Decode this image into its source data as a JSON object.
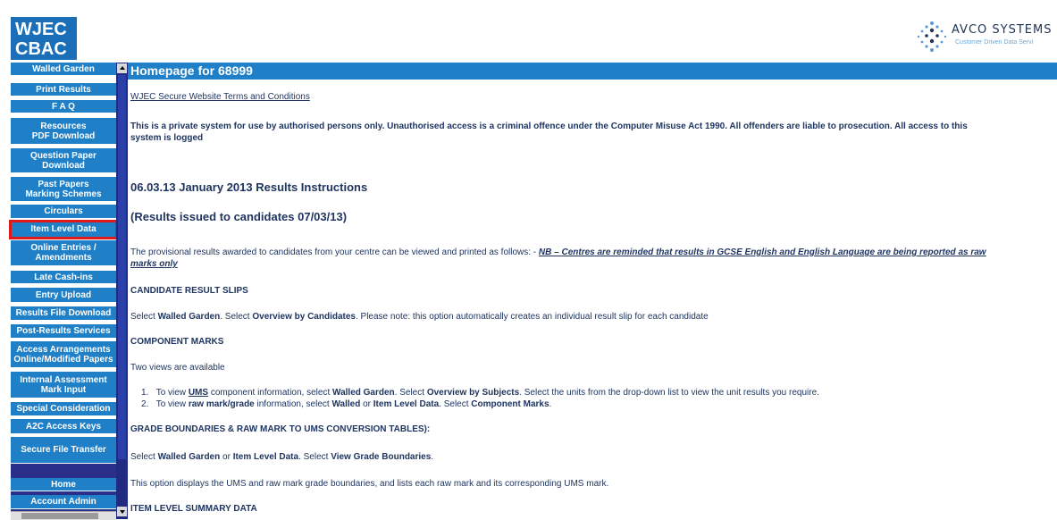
{
  "header": {
    "logo_line1": "WJEC",
    "logo_line2": "CBAC",
    "vendor_name": "AVCO SYSTEMS",
    "vendor_tagline": "Customer Driven Data Servi"
  },
  "nav": {
    "items": [
      {
        "label": "Walled Garden"
      },
      {
        "label": "Print Results"
      },
      {
        "label": "F A Q"
      },
      {
        "label": "Resources\nPDF Download"
      },
      {
        "label": "Question Paper\nDownload"
      },
      {
        "label": "Past Papers\nMarking Schemes"
      },
      {
        "label": "Circulars"
      },
      {
        "label": "Item Level Data"
      },
      {
        "label": "Online Entries /\nAmendments"
      },
      {
        "label": "Late Cash-ins"
      },
      {
        "label": "Entry Upload"
      },
      {
        "label": "Results File Download"
      },
      {
        "label": "Post-Results Services"
      },
      {
        "label": "Access Arrangements\nOnline/Modified Papers"
      },
      {
        "label": "Internal Assessment\nMark Input"
      },
      {
        "label": "Special Consideration"
      },
      {
        "label": "A2C Access Keys"
      },
      {
        "label": "Secure File Transfer"
      }
    ],
    "bottom_items": [
      {
        "label": "Home"
      },
      {
        "label": "Account Admin"
      }
    ]
  },
  "main": {
    "page_title": "Homepage for 68999",
    "terms_link": "WJEC Secure Website Terms and Conditions",
    "notice": "This is a private system for use by authorised persons only. Unauthorised access is a criminal offence under the Computer Misuse Act 1990. All offenders are liable to prosecution. All access to this",
    "notice_line2": "system is logged",
    "instructions_title": "06.03.13 January 2013 Results Instructions",
    "issued_subtitle": "(Results issued to candidates 07/03/13)",
    "provisional_text": "The provisional results awarded to candidates from your centre can be viewed and printed as follows: - ",
    "nb_text": "NB – Centres are reminded that results in GCSE English and English Language are being reported as raw",
    "nb_text2": "marks only",
    "candidate_heading": "CANDIDATE RESULT SLIPS",
    "candidate_text_1": "Select ",
    "candidate_bold_1": "Walled Garden",
    "candidate_text_2": ". Select ",
    "candidate_bold_2": "Overview by Candidates",
    "candidate_text_3": ". Please note: this option automatically creates an individual result slip for each candidate",
    "component_heading": "COMPONENT MARKS",
    "two_views": "Two views are available",
    "item1_num": "1.",
    "item1_a": "To view ",
    "item1_ums": "UMS",
    "item1_b": " component information, select ",
    "item1_c": "Walled Garden",
    "item1_d": ". Select ",
    "item1_e": "Overview by Subjects",
    "item1_f": ". Select the units from the drop-down list to view the unit results you require.",
    "item2_num": "2.",
    "item2_a": "To view ",
    "item2_b": "raw mark/grade",
    "item2_c": " information, select ",
    "item2_d": "Walled",
    "item2_e": " or ",
    "item2_f": "Item Level Data",
    "item2_g": ". Select ",
    "item2_h": "Component Marks",
    "item2_i": ".",
    "grade_heading": "GRADE BOUNDARIES & RAW MARK TO UMS CONVERSION TABLES):",
    "grade_text_1": "Select ",
    "grade_bold_1": "Walled Garden",
    "grade_text_2": " or ",
    "grade_bold_2": "Item Level Data",
    "grade_text_3": ". Select ",
    "grade_bold_3": "View Grade Boundaries",
    "grade_text_4": ".",
    "option_text": "This option displays the UMS and raw mark grade boundaries, and lists each raw mark and its corresponding UMS mark.",
    "item_level_heading": "ITEM LEVEL SUMMARY DATA"
  }
}
